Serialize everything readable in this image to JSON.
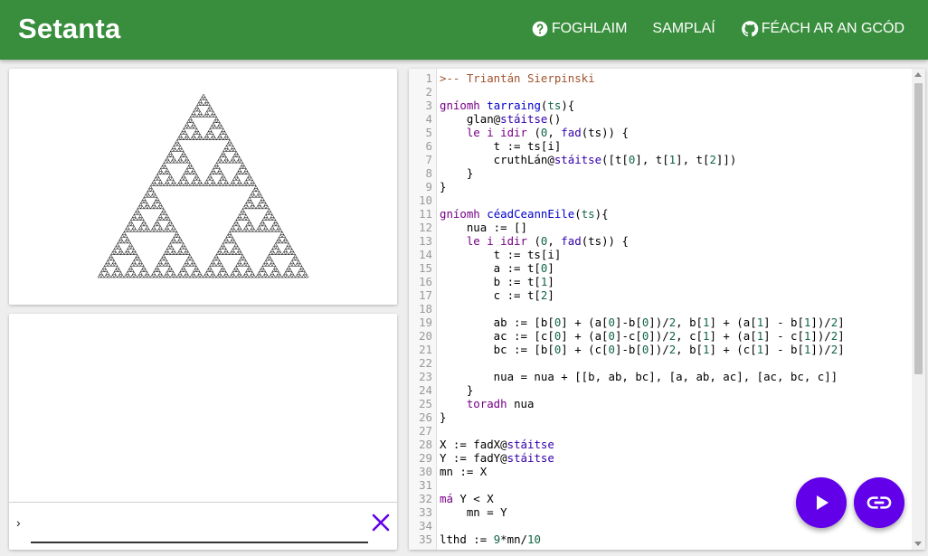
{
  "app": {
    "title": "Setanta"
  },
  "nav": [
    {
      "label": "FOGHLAIM",
      "icon": "help-circle-icon"
    },
    {
      "label": "SAMPLAÍ",
      "icon": ""
    },
    {
      "label": "FÉACH AR AN GCÓD",
      "icon": "github-icon"
    }
  ],
  "colors": {
    "topbar": "#388e3c",
    "accent": "#6200ea"
  },
  "console": {
    "prompt": "›",
    "value": "",
    "clear_icon": "close-icon"
  },
  "canvas": {
    "drawing": "sierpinski-triangle"
  },
  "editor": {
    "lines": [
      {
        "n": "1",
        "html": "<span class=\"cmt\">>-- Triantán Sierpinski</span>"
      },
      {
        "n": "2",
        "html": ""
      },
      {
        "n": "3",
        "html": "<span class=\"kw\">gníomh</span> <span class=\"fn\">tarraing</span>(<span class=\"nm\">ts</span>){"
      },
      {
        "n": "4",
        "html": "    glan@<span class=\"mt\">stáitse</span>()"
      },
      {
        "n": "5",
        "html": "    <span class=\"kw\">le i idir</span> (<span class=\"nm\">0</span>, <span class=\"mt\">fad</span>(ts)) {"
      },
      {
        "n": "6",
        "html": "        t := ts[i]"
      },
      {
        "n": "7",
        "html": "        cruthLán@<span class=\"mt\">stáitse</span>([t[<span class=\"nm\">0</span>], t[<span class=\"nm\">1</span>], t[<span class=\"nm\">2</span>]])"
      },
      {
        "n": "8",
        "html": "    }"
      },
      {
        "n": "9",
        "html": "}"
      },
      {
        "n": "10",
        "html": ""
      },
      {
        "n": "11",
        "html": "<span class=\"kw\">gníomh</span> <span class=\"fn\">céadCeannEile</span>(<span class=\"nm\">ts</span>){"
      },
      {
        "n": "12",
        "html": "    nua := []"
      },
      {
        "n": "13",
        "html": "    <span class=\"kw\">le i idir</span> (<span class=\"nm\">0</span>, <span class=\"mt\">fad</span>(ts)) {"
      },
      {
        "n": "14",
        "html": "        t := ts[i]"
      },
      {
        "n": "15",
        "html": "        a := t[<span class=\"nm\">0</span>]"
      },
      {
        "n": "16",
        "html": "        b := t[<span class=\"nm\">1</span>]"
      },
      {
        "n": "17",
        "html": "        c := t[<span class=\"nm\">2</span>]"
      },
      {
        "n": "18",
        "html": ""
      },
      {
        "n": "19",
        "html": "        ab := [b[<span class=\"nm\">0</span>] + (a[<span class=\"nm\">0</span>]-b[<span class=\"nm\">0</span>])/<span class=\"nm\">2</span>, b[<span class=\"nm\">1</span>] + (a[<span class=\"nm\">1</span>] - b[<span class=\"nm\">1</span>])/<span class=\"nm\">2</span>]"
      },
      {
        "n": "20",
        "html": "        ac := [c[<span class=\"nm\">0</span>] + (a[<span class=\"nm\">0</span>]-c[<span class=\"nm\">0</span>])/<span class=\"nm\">2</span>, c[<span class=\"nm\">1</span>] + (a[<span class=\"nm\">1</span>] - c[<span class=\"nm\">1</span>])/<span class=\"nm\">2</span>]"
      },
      {
        "n": "21",
        "html": "        bc := [b[<span class=\"nm\">0</span>] + (c[<span class=\"nm\">0</span>]-b[<span class=\"nm\">0</span>])/<span class=\"nm\">2</span>, b[<span class=\"nm\">1</span>] + (c[<span class=\"nm\">1</span>] - b[<span class=\"nm\">1</span>])/<span class=\"nm\">2</span>]"
      },
      {
        "n": "22",
        "html": ""
      },
      {
        "n": "23",
        "html": "        nua = nua + [[b, ab, bc], [a, ab, ac], [ac, bc, c]]"
      },
      {
        "n": "24",
        "html": "    }"
      },
      {
        "n": "25",
        "html": "    <span class=\"kw\">toradh</span> nua"
      },
      {
        "n": "26",
        "html": "}"
      },
      {
        "n": "27",
        "html": ""
      },
      {
        "n": "28",
        "html": "X := fadX@<span class=\"mt\">stáitse</span>"
      },
      {
        "n": "29",
        "html": "Y := fadY@<span class=\"mt\">stáitse</span>"
      },
      {
        "n": "30",
        "html": "mn := X"
      },
      {
        "n": "31",
        "html": ""
      },
      {
        "n": "32",
        "html": "<span class=\"kw\">má</span> Y < X"
      },
      {
        "n": "33",
        "html": "    mn = Y"
      },
      {
        "n": "34",
        "html": ""
      },
      {
        "n": "35",
        "html": "lthd := <span class=\"nm\">9</span>*mn/<span class=\"nm\">10</span>"
      }
    ]
  },
  "actions": {
    "run_icon": "play-icon",
    "share_icon": "link-icon"
  }
}
